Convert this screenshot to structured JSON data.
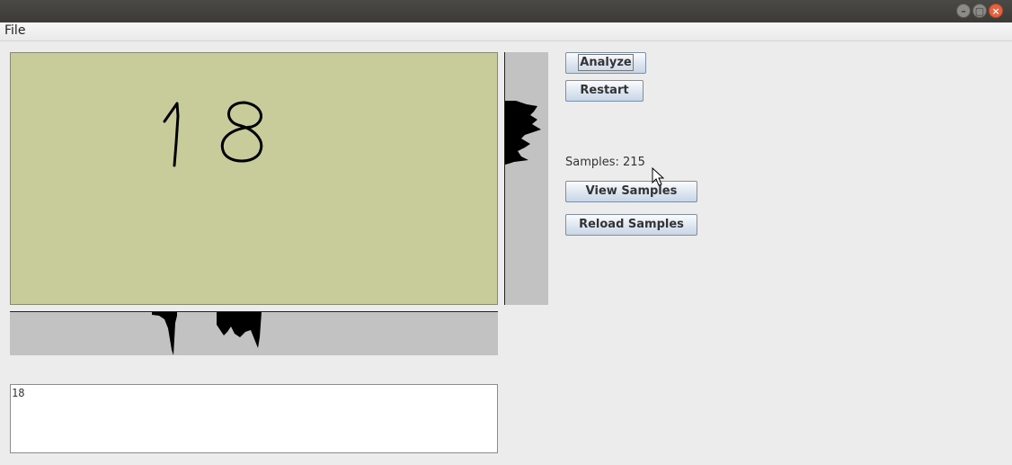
{
  "window": {
    "controls": {
      "minimize_icon": "minimize-icon",
      "maximize_icon": "maximize-icon",
      "close_icon": "close-icon",
      "minimize_glyph": "–",
      "maximize_glyph": "▢",
      "close_glyph": "×",
      "close_color": "#e8603c"
    }
  },
  "menu": {
    "file": "File"
  },
  "drawing": {
    "background_color": "#c8cb9a",
    "strokes": [
      "1",
      "8"
    ],
    "projection_color": "#c2c2c2"
  },
  "buttons": {
    "analyze": "Analyze",
    "restart": "Restart",
    "view_samples": "View Samples",
    "reload_samples": "Reload Samples"
  },
  "samples": {
    "label": "Samples: 215"
  },
  "output": {
    "text": "18"
  }
}
